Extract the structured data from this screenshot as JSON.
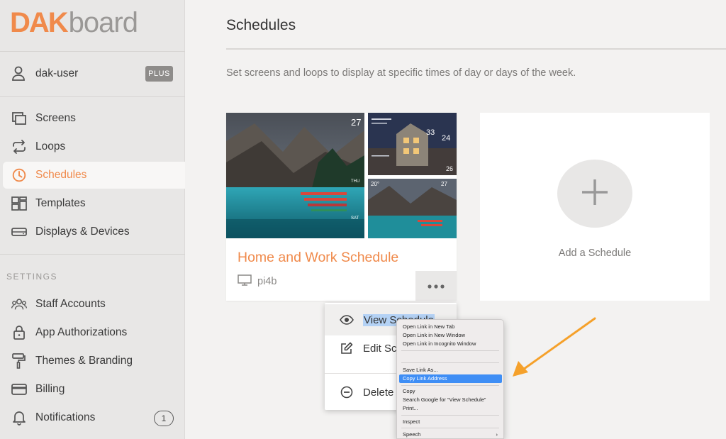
{
  "brand": {
    "dak": "DAK",
    "board": "board",
    "accent": "#f08a4b"
  },
  "user": {
    "name": "dak-user",
    "plan": "PLUS"
  },
  "nav": {
    "screens": "Screens",
    "loops": "Loops",
    "schedules": "Schedules",
    "templates": "Templates",
    "displays": "Displays & Devices"
  },
  "settings": {
    "heading": "SETTINGS",
    "staff": "Staff Accounts",
    "apps": "App Authorizations",
    "themes": "Themes & Branding",
    "billing": "Billing",
    "notifications": "Notifications",
    "notifications_count": "1"
  },
  "main": {
    "title": "Schedules",
    "subtitle": "Set screens and loops to display at specific times of day or days of the week."
  },
  "card": {
    "title": "Home and Work Schedule",
    "device": "pi4b",
    "more_icon": "ellipsis-icon"
  },
  "add_card": {
    "label": "Add a Schedule"
  },
  "dropdown": {
    "view": "View Schedule",
    "edit": "Edit Sc",
    "delete": "Delete"
  },
  "context_menu": {
    "open_tab": "Open Link in New Tab",
    "open_window": "Open Link in New Window",
    "open_incognito": "Open Link in Incognito Window",
    "save_link": "Save Link As...",
    "copy_link": "Copy Link Address",
    "copy": "Copy",
    "search": "Search Google for “View Schedule”",
    "print": "Print...",
    "inspect": "Inspect",
    "speech": "Speech",
    "speech_arrow": "›"
  },
  "thumbs": {
    "main_temp": "27",
    "main_day1": "THU",
    "main_day2": "SAT",
    "tr_temps": [
      "33",
      "24",
      "26"
    ],
    "br_temp": "20°",
    "br_temp2": "27"
  }
}
